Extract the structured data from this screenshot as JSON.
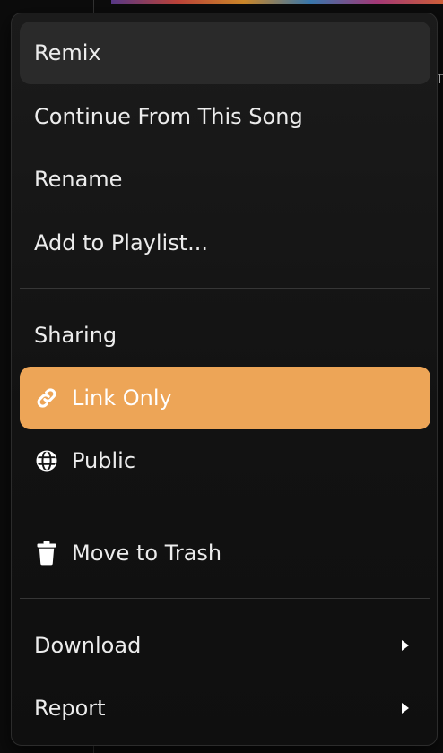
{
  "menu": {
    "items": {
      "remix": "Remix",
      "continue": "Continue From This Song",
      "rename": "Rename",
      "add_playlist": "Add to Playlist...",
      "sharing_header": "Sharing",
      "link_only": "Link Only",
      "public": "Public",
      "trash": "Move to Trash",
      "download": "Download",
      "report": "Report"
    },
    "icons": {
      "link_only": "link-icon",
      "public": "globe-icon",
      "trash": "trash-icon",
      "submenu": "chevron-right-icon"
    },
    "colors": {
      "selected_bg": "#eda557",
      "hover_bg": "#2a2a2a",
      "menu_bg": "#151515",
      "text": "#ececec"
    }
  }
}
